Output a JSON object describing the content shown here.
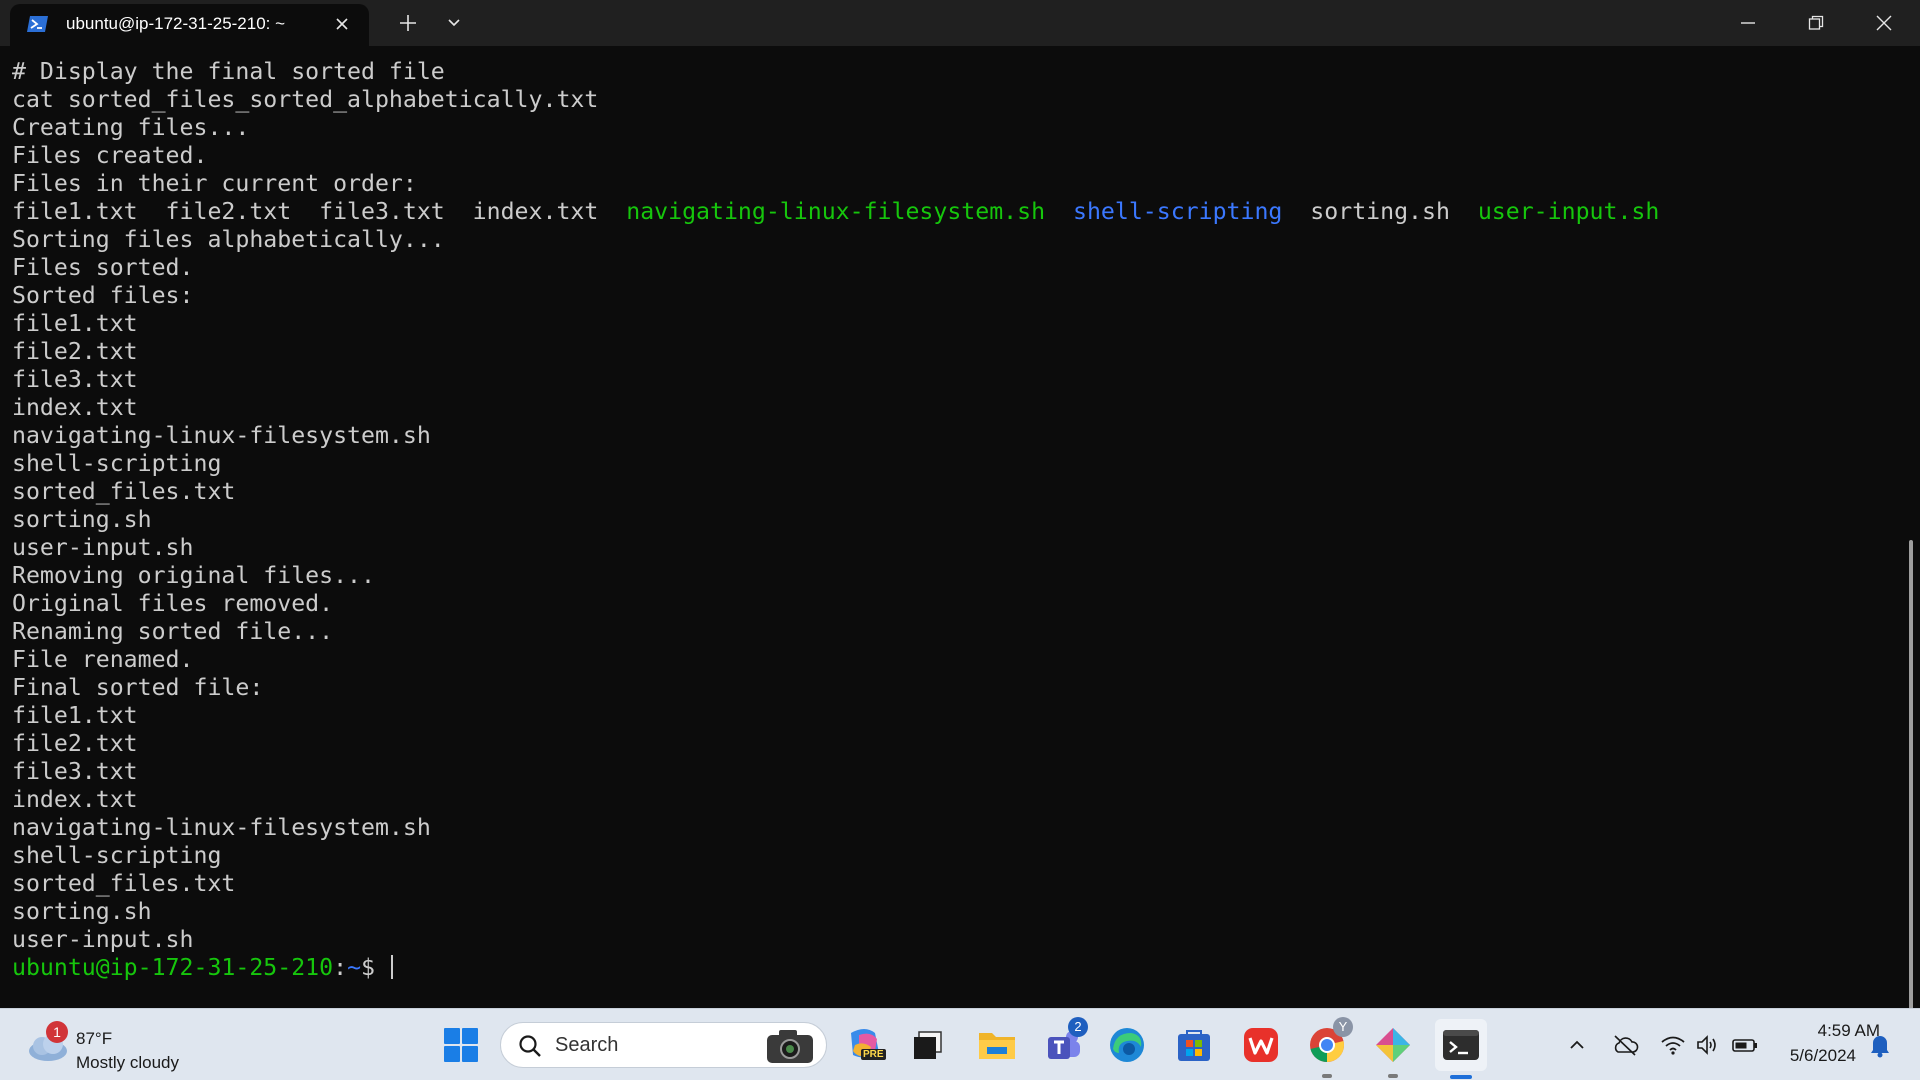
{
  "window": {
    "tab_title": "ubuntu@ip-172-31-25-210: ~"
  },
  "terminal": {
    "lines": [
      [
        {
          "t": "# Display the final sorted file",
          "c": "white"
        }
      ],
      [
        {
          "t": "cat sorted_files_sorted_alphabetically.txt",
          "c": "white"
        }
      ],
      [
        {
          "t": "Creating files...",
          "c": "white"
        }
      ],
      [
        {
          "t": "Files created.",
          "c": "white"
        }
      ],
      [
        {
          "t": "Files in their current order:",
          "c": "white"
        }
      ],
      [
        {
          "t": "file1.txt  file2.txt  file3.txt  index.txt  ",
          "c": "white"
        },
        {
          "t": "navigating-linux-filesystem.sh",
          "c": "green"
        },
        {
          "t": "  ",
          "c": "white"
        },
        {
          "t": "shell-scripting",
          "c": "blue"
        },
        {
          "t": "  sorting.sh  ",
          "c": "white"
        },
        {
          "t": "user-input.sh",
          "c": "green"
        }
      ],
      [
        {
          "t": "Sorting files alphabetically...",
          "c": "white"
        }
      ],
      [
        {
          "t": "Files sorted.",
          "c": "white"
        }
      ],
      [
        {
          "t": "Sorted files:",
          "c": "white"
        }
      ],
      [
        {
          "t": "file1.txt",
          "c": "white"
        }
      ],
      [
        {
          "t": "file2.txt",
          "c": "white"
        }
      ],
      [
        {
          "t": "file3.txt",
          "c": "white"
        }
      ],
      [
        {
          "t": "index.txt",
          "c": "white"
        }
      ],
      [
        {
          "t": "navigating-linux-filesystem.sh",
          "c": "white"
        }
      ],
      [
        {
          "t": "shell-scripting",
          "c": "white"
        }
      ],
      [
        {
          "t": "sorted_files.txt",
          "c": "white"
        }
      ],
      [
        {
          "t": "sorting.sh",
          "c": "white"
        }
      ],
      [
        {
          "t": "user-input.sh",
          "c": "white"
        }
      ],
      [
        {
          "t": "Removing original files...",
          "c": "white"
        }
      ],
      [
        {
          "t": "Original files removed.",
          "c": "white"
        }
      ],
      [
        {
          "t": "Renaming sorted file...",
          "c": "white"
        }
      ],
      [
        {
          "t": "File renamed.",
          "c": "white"
        }
      ],
      [
        {
          "t": "Final sorted file:",
          "c": "white"
        }
      ],
      [
        {
          "t": "file1.txt",
          "c": "white"
        }
      ],
      [
        {
          "t": "file2.txt",
          "c": "white"
        }
      ],
      [
        {
          "t": "file3.txt",
          "c": "white"
        }
      ],
      [
        {
          "t": "index.txt",
          "c": "white"
        }
      ],
      [
        {
          "t": "navigating-linux-filesystem.sh",
          "c": "white"
        }
      ],
      [
        {
          "t": "shell-scripting",
          "c": "white"
        }
      ],
      [
        {
          "t": "sorted_files.txt",
          "c": "white"
        }
      ],
      [
        {
          "t": "sorting.sh",
          "c": "white"
        }
      ],
      [
        {
          "t": "user-input.sh",
          "c": "white"
        }
      ]
    ],
    "prompt": {
      "user_host": "ubuntu@ip-172-31-25-210",
      "separator": ":",
      "path": "~",
      "symbol": "$ "
    }
  },
  "taskbar": {
    "weather": {
      "badge": "1",
      "temperature": "87°F",
      "condition": "Mostly cloudy"
    },
    "search_placeholder": "Search",
    "teams_badge": "2",
    "chrome_badge": "Y",
    "copilot_label": "PRE",
    "clock": {
      "time": "4:59 AM",
      "date": "5/6/2024"
    }
  },
  "colors": {
    "terminal_bg": "#0c0c0c",
    "text": "#cccccc",
    "green": "#16c60c",
    "blue": "#3b78ff",
    "taskbar_bg": "#dfe6ef"
  }
}
